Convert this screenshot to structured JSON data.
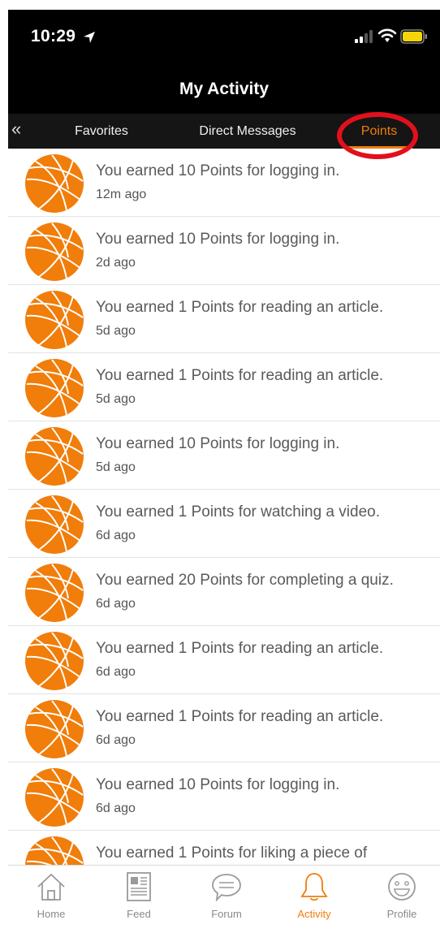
{
  "status_bar": {
    "time": "10:29"
  },
  "header": {
    "title": "My Activity"
  },
  "tabs": {
    "back_glyph": "«",
    "items": [
      {
        "label": "Favorites",
        "active": false
      },
      {
        "label": "Direct Messages",
        "active": false
      },
      {
        "label": "Points",
        "active": true
      }
    ]
  },
  "colors": {
    "accent": "#f17d0a",
    "annotation": "#e2101b",
    "header_bg": "#000000"
  },
  "activity": [
    {
      "text": "You earned 10 Points for logging in.",
      "time": "12m ago"
    },
    {
      "text": "You earned 10 Points for logging in.",
      "time": "2d ago"
    },
    {
      "text": "You earned 1 Points for reading an article.",
      "time": "5d ago"
    },
    {
      "text": "You earned 1 Points for reading an article.",
      "time": "5d ago"
    },
    {
      "text": "You earned 10 Points for logging in.",
      "time": "5d ago"
    },
    {
      "text": "You earned 1 Points for watching a video.",
      "time": "6d ago"
    },
    {
      "text": "You earned 20 Points for completing a quiz.",
      "time": "6d ago"
    },
    {
      "text": "You earned 1 Points for reading an article.",
      "time": "6d ago"
    },
    {
      "text": "You earned 1 Points for reading an article.",
      "time": "6d ago"
    },
    {
      "text": "You earned 10 Points for logging in.",
      "time": "6d ago"
    },
    {
      "text": "You earned 1 Points for liking a piece of",
      "time": ""
    }
  ],
  "bottom_nav": [
    {
      "label": "Home",
      "icon": "home-icon",
      "active": false
    },
    {
      "label": "Feed",
      "icon": "feed-icon",
      "active": false
    },
    {
      "label": "Forum",
      "icon": "forum-icon",
      "active": false
    },
    {
      "label": "Activity",
      "icon": "bell-icon",
      "active": true
    },
    {
      "label": "Profile",
      "icon": "profile-icon",
      "active": false
    }
  ]
}
